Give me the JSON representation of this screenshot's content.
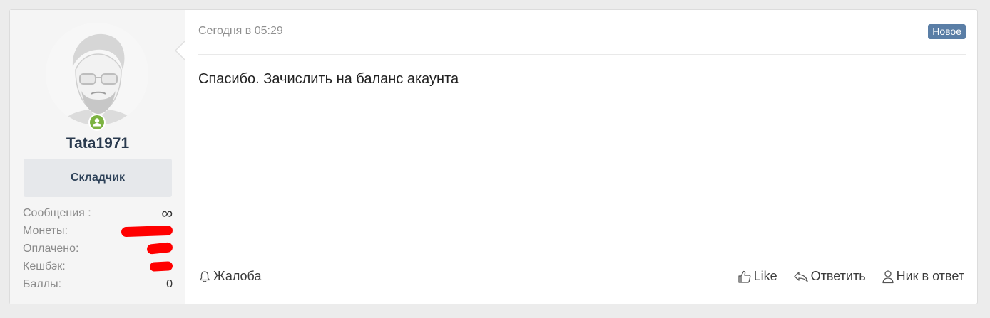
{
  "user": {
    "name": "Tata1971",
    "role": "Складчик",
    "avatar_icon": "user-avatar-illustration",
    "online_icon": "online-status-icon",
    "stats": [
      {
        "label": "Сообщения :",
        "value": "∞"
      },
      {
        "label": "Монеты:",
        "value": ""
      },
      {
        "label": "Оплачено:",
        "value": ""
      },
      {
        "label": "Кешбэк:",
        "value": ""
      },
      {
        "label": "Баллы:",
        "value": "0"
      }
    ]
  },
  "post": {
    "date": "Сегодня в 05:29",
    "badge": "Новое",
    "text": "Спасибо. Зачислить на баланс акаунта"
  },
  "actions": {
    "report": "Жалоба",
    "like": "Like",
    "reply": "Ответить",
    "mention": "Ник в ответ"
  },
  "colors": {
    "badge": "#5a7ea6",
    "online": "#7cb342",
    "redaction": "#ff0000"
  }
}
